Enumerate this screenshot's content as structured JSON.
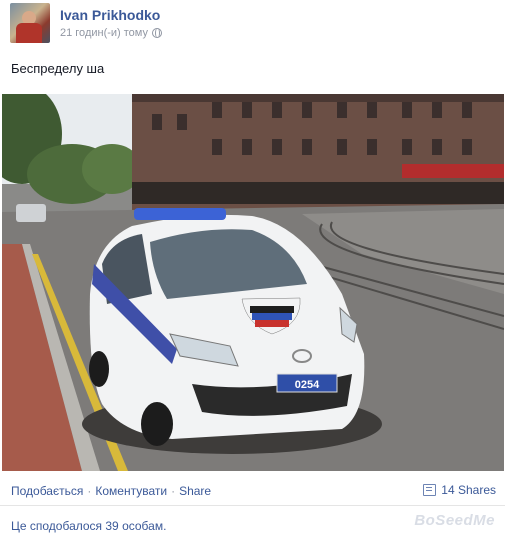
{
  "post": {
    "author": "Ivan Prikhodko",
    "timestamp": "21 годин(-и) тому",
    "privacy_icon": "globe-icon",
    "text": "Беспределу ша",
    "photo": {
      "description_icon": "police-car-photo",
      "license_plate": "0254"
    }
  },
  "actions": {
    "like": "Подобається",
    "comment": "Коментувати",
    "share": "Share",
    "separator": "·",
    "shares_count": "14 Shares"
  },
  "likes_summary": "Це сподобалося 39 особам.",
  "watermark": "BoSeedMe",
  "colors": {
    "link": "#3b5998",
    "meta": "#9197a3"
  }
}
